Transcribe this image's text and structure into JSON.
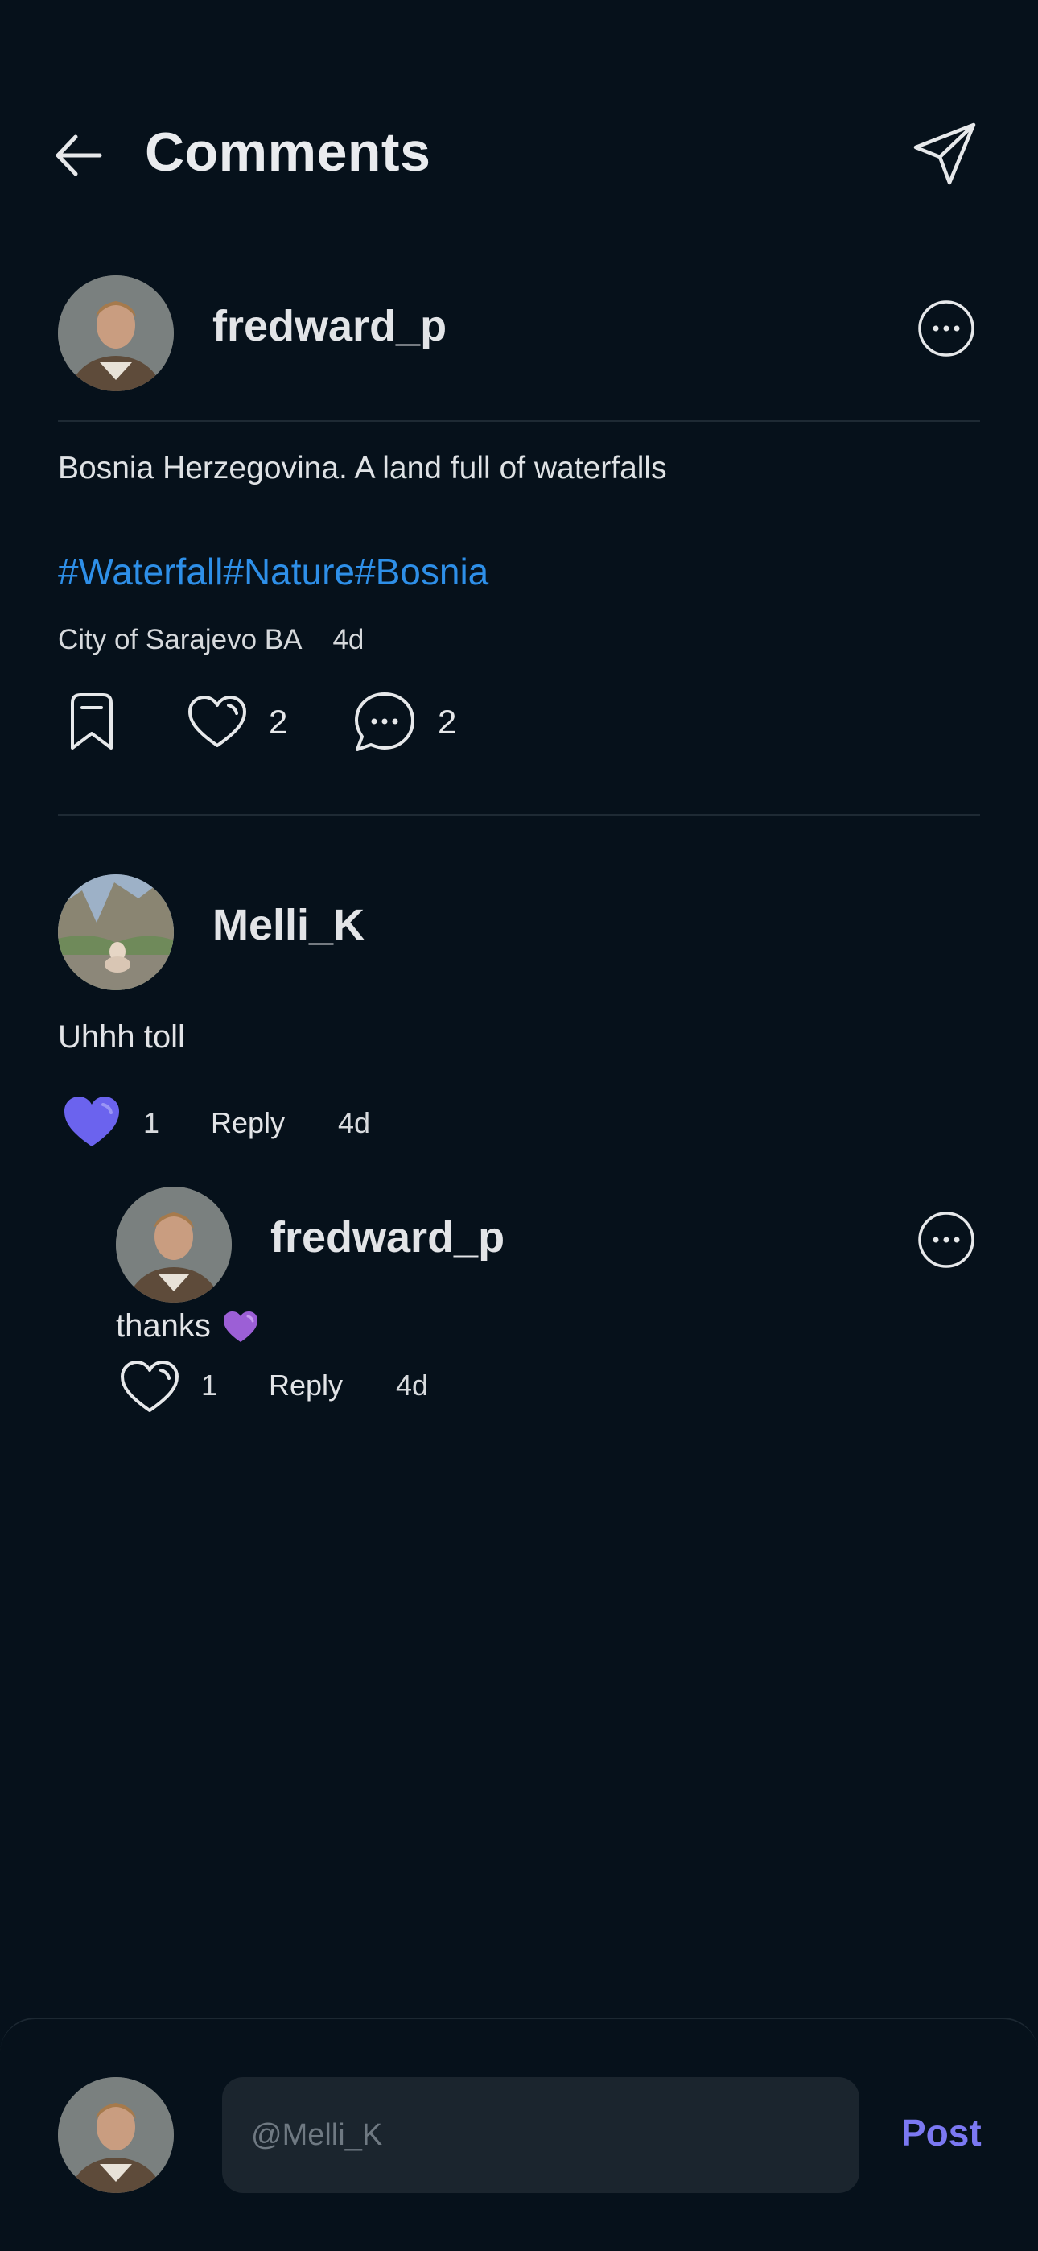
{
  "header": {
    "title": "Comments",
    "back_icon": "arrow-left-icon",
    "share_icon": "send-icon"
  },
  "post": {
    "username": "fredward_p",
    "text": "Bosnia Herzegovina. A land full of waterfalls",
    "hashtags": "#Waterfall#Nature#Bosnia",
    "location": "City of Sarajevo BA",
    "time": "4d",
    "likes": "2",
    "comments": "2"
  },
  "comment": {
    "username": "Melli_K",
    "text": "Uhhh toll",
    "likes": "1",
    "reply_label": "Reply",
    "time": "4d",
    "liked": true
  },
  "reply": {
    "username": "fredward_p",
    "text": "thanks",
    "likes": "1",
    "reply_label": "Reply",
    "time": "4d"
  },
  "composer": {
    "placeholder": "@Melli_K",
    "post_label": "Post"
  },
  "colors": {
    "background": "#06111b",
    "hashtag": "#2e8fe8",
    "accent": "#7b78f2",
    "like_fill": "#6b63ee",
    "input_bg": "#1b252e"
  }
}
